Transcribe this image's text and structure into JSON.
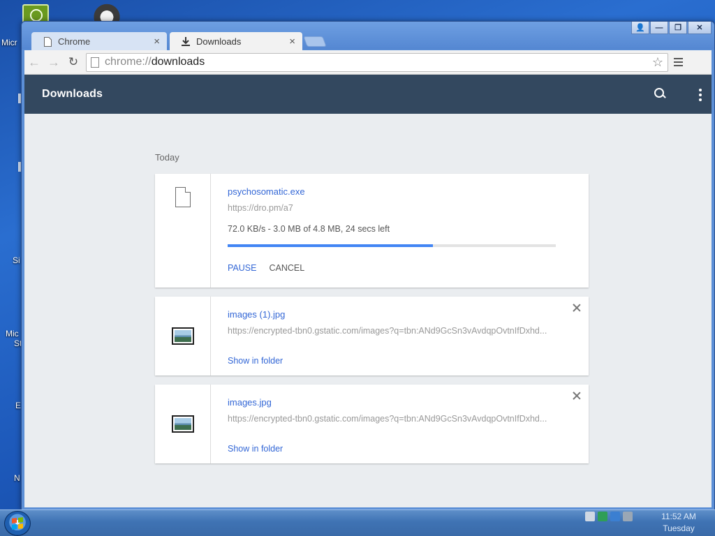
{
  "desktop": {
    "icon_labels": [
      "Micr",
      "Si",
      "Mic",
      "St",
      "E",
      "N"
    ]
  },
  "window": {
    "tabs": [
      {
        "label": "Chrome",
        "icon": "page-icon",
        "close": "×"
      },
      {
        "label": "Downloads",
        "icon": "download-icon",
        "close": "×"
      }
    ],
    "controls": {
      "user": "👤",
      "minimize": "—",
      "maximize": "❐",
      "close": "✕"
    }
  },
  "toolbar": {
    "back": "←",
    "forward": "→",
    "reload": "↻",
    "url_scheme": "chrome://",
    "url_path": "downloads",
    "star": "☆"
  },
  "page": {
    "title": "Downloads",
    "section_label": "Today",
    "downloads": [
      {
        "file_name": "psychosomatic.exe",
        "url": "https://dro.pm/a7",
        "status": "72.0 KB/s - 3.0 MB of 4.8 MB, 24 secs left",
        "progress": 0.625,
        "pause_label": "PAUSE",
        "cancel_label": "CANCEL",
        "icon": "document-icon"
      },
      {
        "file_name": "images (1).jpg",
        "url": "https://encrypted-tbn0.gstatic.com/images?q=tbn:ANd9GcSn3vAvdqpOvtnIfDxhd...",
        "action_label": "Show in folder",
        "icon": "image-file-icon"
      },
      {
        "file_name": "images.jpg",
        "url": "https://encrypted-tbn0.gstatic.com/images?q=tbn:ANd9GcSn3vAvdqpOvtnIfDxhd...",
        "action_label": "Show in folder",
        "icon": "image-file-icon"
      }
    ]
  },
  "taskbar": {
    "time": "11:52 AM",
    "day": "Tuesday"
  },
  "colors": {
    "header_bg": "#33485f",
    "link_blue": "#3367d6",
    "progress_blue": "#4285f4",
    "page_bg": "#eaedf0"
  }
}
